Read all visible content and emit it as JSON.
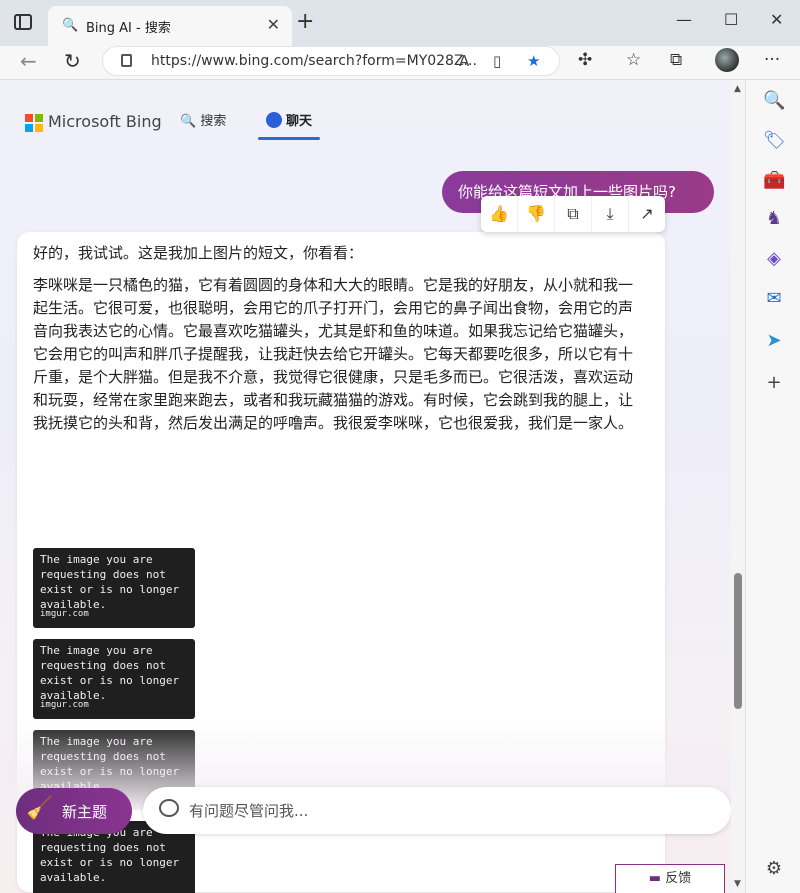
{
  "tab": {
    "title": "Bing AI - 搜索",
    "favicon": "search-icon",
    "close": "✕",
    "new_tab": "+"
  },
  "window": {
    "minimize": "—",
    "maximize": "☐",
    "close": "✕"
  },
  "address": {
    "url": "https://www.bing.com/search?form=MY028Z..."
  },
  "nav": {
    "back": "←",
    "refresh": "↻"
  },
  "logo": {
    "text": "Microsoft Bing"
  },
  "header": {
    "search_label": "搜索",
    "chat_label": "聊天"
  },
  "chat": {
    "user_message": "你能给这篇短文加上一些图片吗?",
    "bot_intro": "好的，我试试。这是我加上图片的短文，你看看：",
    "bot_story": "李咪咪是一只橘色的猫，它有着圆圆的身体和大大的眼睛。它是我的好朋友，从小就和我一起生活。它很可爱，也很聪明，会用它的爪子打开门，会用它的鼻子闻出食物，会用它的声音向我表达它的心情。它最喜欢吃猫罐头，尤其是虾和鱼的味道。如果我忘记给它猫罐头，它会用它的叫声和胖爪子提醒我，让我赶快去给它开罐头。它每天都要吃很多，所以它有十斤重，是个大胖猫。但是我不介意，我觉得它很健康，只是毛多而已。它很活泼，喜欢运动和玩耍，经常在家里跑来跑去，或者和我玩藏猫猫的游戏。有时候，它会跳到我的腿上，让我抚摸它的头和背，然后发出满足的呼噜声。我很爱李咪咪，它也很爱我，我们是一家人。",
    "image_placeholder_text": "The image you are requesting does not exist or is no longer available.",
    "image_source": "imgur.com"
  },
  "actions": {
    "like": "👍",
    "dislike": "👎",
    "copy": "⧉",
    "export": "⤓",
    "share": "↗"
  },
  "footer": {
    "new_topic": "新主题",
    "ask_placeholder": "有问题尽管问我...",
    "feedback": "反馈"
  },
  "colors": {
    "accent": "#8a3490",
    "brand_blue": "#2b6bd1"
  }
}
